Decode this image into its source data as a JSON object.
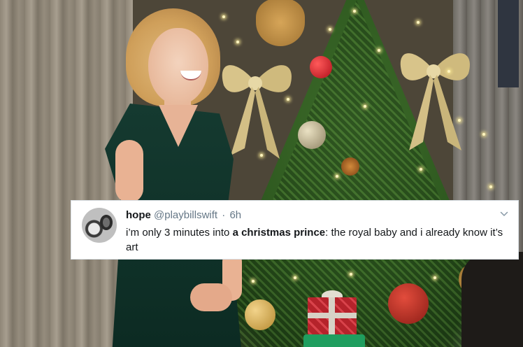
{
  "tweet": {
    "name": "hope",
    "handle": "@playbillswift",
    "separator": "·",
    "time": "6h",
    "text_before": "i’m only 3 minutes into ",
    "text_bold": "a christmas prince",
    "text_after": ": the royal baby and i already know it’s art"
  },
  "icons": {
    "avatar": "profile-photo",
    "menu": "chevron-down-icon"
  },
  "colors": {
    "name": "#14171a",
    "secondary": "#657786",
    "card_bg": "#ffffff"
  }
}
